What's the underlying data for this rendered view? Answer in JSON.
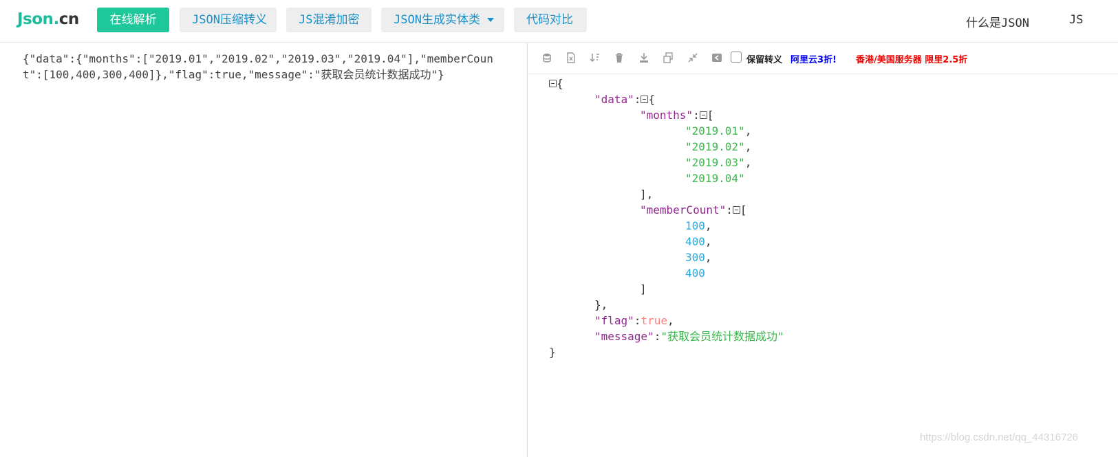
{
  "header": {
    "logo": {
      "part1": "Json",
      "part2": ".",
      "part3": "cn"
    },
    "nav": [
      {
        "label": "在线解析",
        "active": true
      },
      {
        "label": "JSON压缩转义"
      },
      {
        "label": "JS混淆加密"
      },
      {
        "label": "JSON生成实体类"
      },
      {
        "label": "代码对比"
      }
    ],
    "right_links": [
      "什么是JSON",
      "JS"
    ]
  },
  "editor": {
    "raw_text": "{\"data\":{\"months\":[\"2019.01\",\"2019.02\",\"2019.03\",\"2019.04\"],\"memberCount\":[100,400,300,400]},\"flag\":true,\"message\":\"获取会员统计数据成功\"}"
  },
  "toolbar": {
    "icons": [
      "database-icon",
      "excel-icon",
      "sort-icon",
      "trash-icon",
      "download-icon",
      "copy-icon",
      "compress-icon",
      "back-icon"
    ],
    "keep_escape_label": "保留转义",
    "promo_aliyun": "阿里云3折!",
    "promo_server": "香港/美国服务器 限里2.5折"
  },
  "tree": {
    "keys": {
      "data": "\"data\"",
      "months": "\"months\"",
      "memberCount": "\"memberCount\"",
      "flag": "\"flag\"",
      "message": "\"message\""
    },
    "months": [
      "\"2019.01\"",
      "\"2019.02\"",
      "\"2019.03\"",
      "\"2019.04\""
    ],
    "memberCount": [
      "100",
      "400",
      "300",
      "400"
    ],
    "flag": "true",
    "message": "\"获取会员统计数据成功\""
  },
  "watermark": "https://blog.csdn.net/qq_44316726"
}
